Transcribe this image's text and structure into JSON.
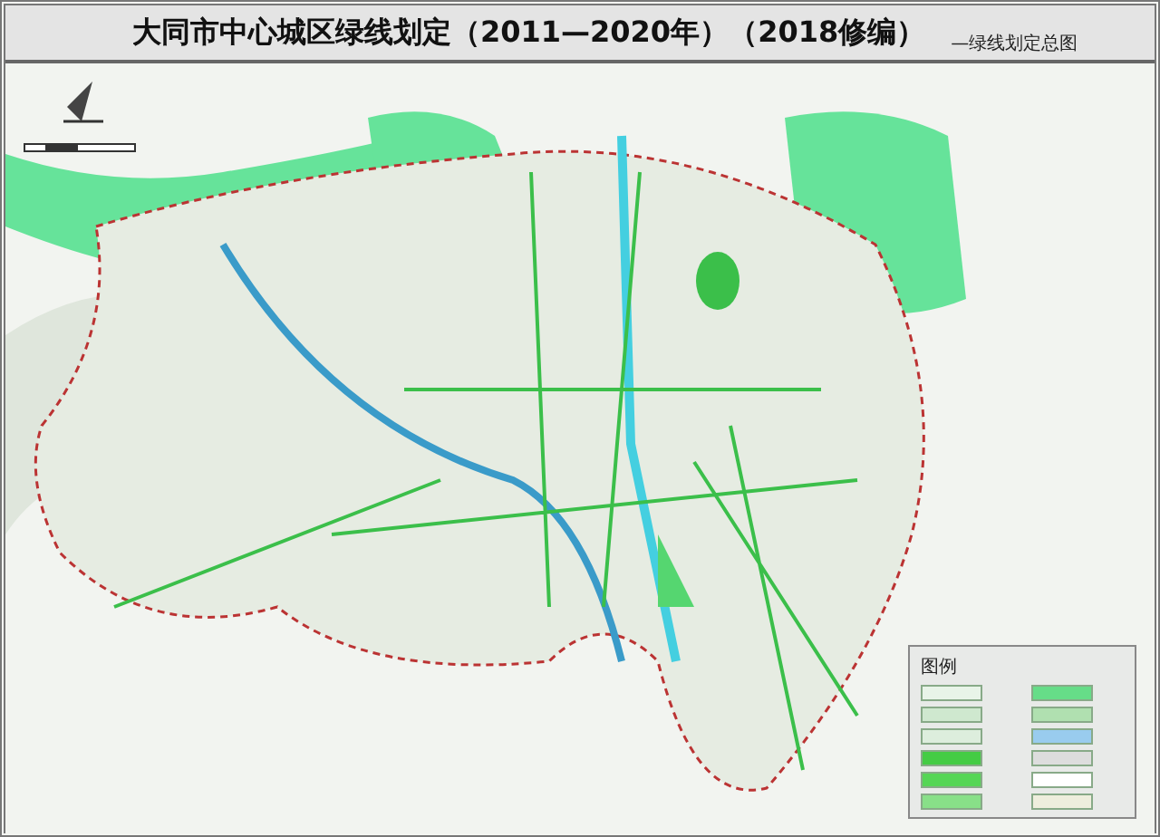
{
  "title": "大同市中心城区绿线划定（2011—2020年）（2018修编）",
  "subtitle": "—绿线划定总图",
  "legend": {
    "title": "图例",
    "items": [
      {
        "color": "#e8f4e8"
      },
      {
        "color": "#66dd88"
      },
      {
        "color": "#cfe8cf"
      },
      {
        "color": "#b0e0b0"
      },
      {
        "color": "#ddeedd"
      },
      {
        "color": "#99ccee"
      },
      {
        "color": "#44cc44"
      },
      {
        "color": "#dddddd"
      },
      {
        "color": "#55d655"
      },
      {
        "color": "#ffffff"
      },
      {
        "color": "#88e088"
      },
      {
        "color": "#eeeedd"
      }
    ]
  }
}
